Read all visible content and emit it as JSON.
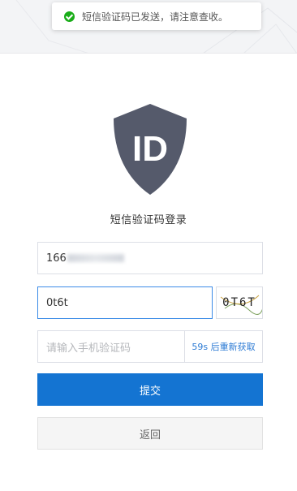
{
  "toast": {
    "icon": "success-check-icon",
    "message": "短信验证码已发送，请注意查收。",
    "color": "#1aad19"
  },
  "logo": {
    "text": "ID",
    "icon": "shield-id-icon",
    "color": "#555a6b"
  },
  "page": {
    "title": "短信验证码登录"
  },
  "form": {
    "phone_visible": "166",
    "captcha_value": "0t6t",
    "captcha_image_text": "0T6T",
    "sms_placeholder": "请输入手机验证码",
    "resend_label": "59s 后重新获取"
  },
  "buttons": {
    "submit_label": "提交",
    "back_label": "返回",
    "primary_color": "#1474d2"
  }
}
